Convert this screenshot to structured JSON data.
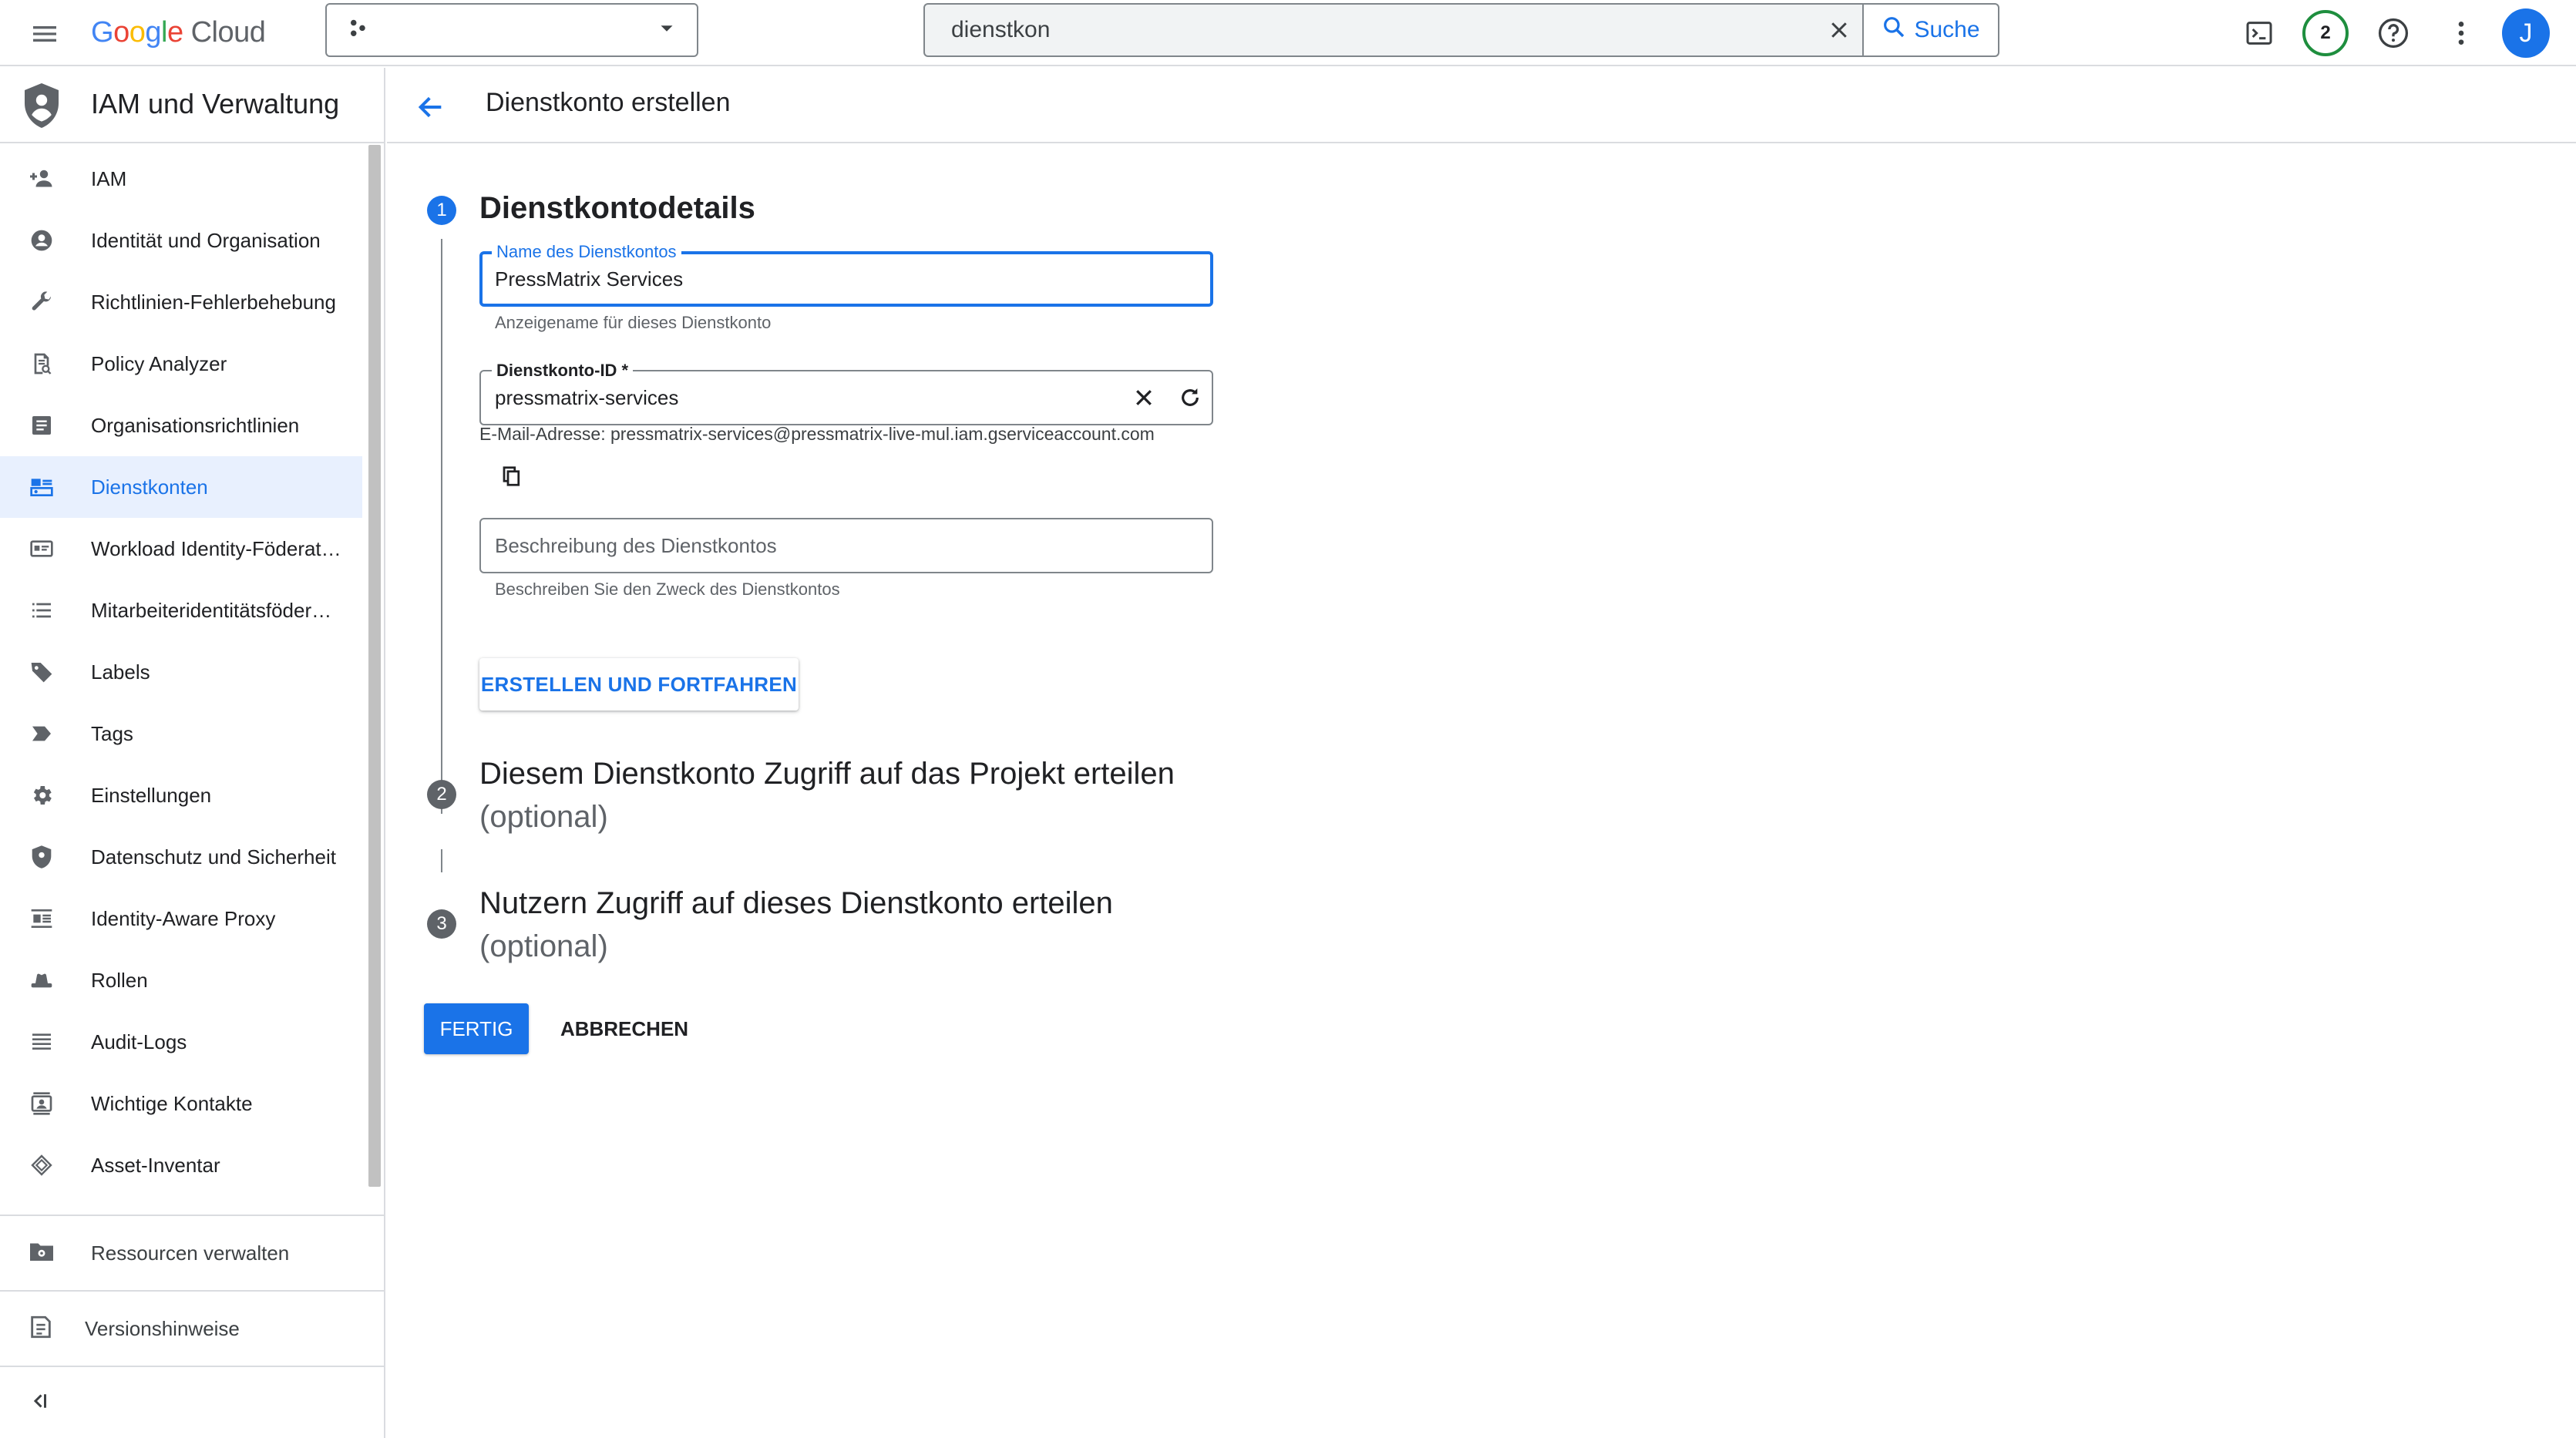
{
  "topbar": {
    "menu_icon": "hamburger-menu-icon",
    "logo": {
      "google": [
        "G",
        "o",
        "o",
        "g",
        "l",
        "e"
      ],
      "cloud": "Cloud"
    },
    "project_picker": {
      "icon": "project-dots-icon",
      "value": ""
    },
    "search": {
      "value": "dienstkon",
      "button_label": "Suche"
    },
    "notifications_count": "2",
    "avatar_letter": "J"
  },
  "sidebar": {
    "title": "IAM und Verwaltung",
    "items": [
      {
        "label": "IAM",
        "icon": "person-add-icon",
        "active": false
      },
      {
        "label": "Identität und Organisation",
        "icon": "account-circle-icon",
        "active": false
      },
      {
        "label": "Richtlinien-Fehlerbehebung",
        "icon": "wrench-icon",
        "active": false
      },
      {
        "label": "Policy Analyzer",
        "icon": "policy-search-icon",
        "active": false
      },
      {
        "label": "Organisationsrichtlinien",
        "icon": "document-list-icon",
        "active": false
      },
      {
        "label": "Dienstkonten",
        "icon": "service-account-icon",
        "active": true
      },
      {
        "label": "Workload Identity-Föderat…",
        "icon": "id-card-icon",
        "active": false
      },
      {
        "label": "Mitarbeiteridentitätsföder…",
        "icon": "list-icon",
        "active": false
      },
      {
        "label": "Labels",
        "icon": "label-tag-icon",
        "active": false
      },
      {
        "label": "Tags",
        "icon": "tag-arrow-icon",
        "active": false
      },
      {
        "label": "Einstellungen",
        "icon": "gear-icon",
        "active": false
      },
      {
        "label": "Datenschutz und Sicherheit",
        "icon": "shield-icon",
        "active": false
      },
      {
        "label": "Identity-Aware Proxy",
        "icon": "proxy-icon",
        "active": false
      },
      {
        "label": "Rollen",
        "icon": "hat-icon",
        "active": false
      },
      {
        "label": "Audit-Logs",
        "icon": "lines-icon",
        "active": false
      },
      {
        "label": "Wichtige Kontakte",
        "icon": "contact-card-icon",
        "active": false
      },
      {
        "label": "Asset-Inventar",
        "icon": "diamond-icon",
        "active": false
      }
    ],
    "manage_resources": "Ressourcen verwalten",
    "release_notes": "Versionshinweise",
    "collapse_icon": "collapse-sidebar-icon"
  },
  "page": {
    "back_icon": "back-arrow-icon",
    "title": "Dienstkonto erstellen"
  },
  "steps": [
    {
      "number": "1",
      "title": "Dienstkontodetails",
      "optional": ""
    },
    {
      "number": "2",
      "title": "Diesem Dienstkonto Zugriff auf das Projekt erteilen",
      "optional": "(optional)"
    },
    {
      "number": "3",
      "title": "Nutzern Zugriff auf dieses Dienstkonto erteilen",
      "optional": "(optional)"
    }
  ],
  "form": {
    "name": {
      "label": "Name des Dienstkontos",
      "value": "PressMatrix Services",
      "hint": "Anzeigename für dieses Dienstkonto"
    },
    "id": {
      "label": "Dienstkonto-ID *",
      "value": "pressmatrix-services"
    },
    "email_line": "E-Mail-Adresse: pressmatrix-services@pressmatrix-live-mul.iam.gserviceaccount.com",
    "description": {
      "placeholder": "Beschreibung des Dienstkontos",
      "hint": "Beschreiben Sie den Zweck des Dienstkontos"
    },
    "create_button": "ERSTELLEN UND FORTFAHREN"
  },
  "actions": {
    "done": "FERTIG",
    "cancel": "ABBRECHEN"
  },
  "colors": {
    "accent": "#1a73e8",
    "active_bg": "#e8f0fe",
    "border": "#dadce0",
    "notif_ring": "#1e8e3e"
  }
}
